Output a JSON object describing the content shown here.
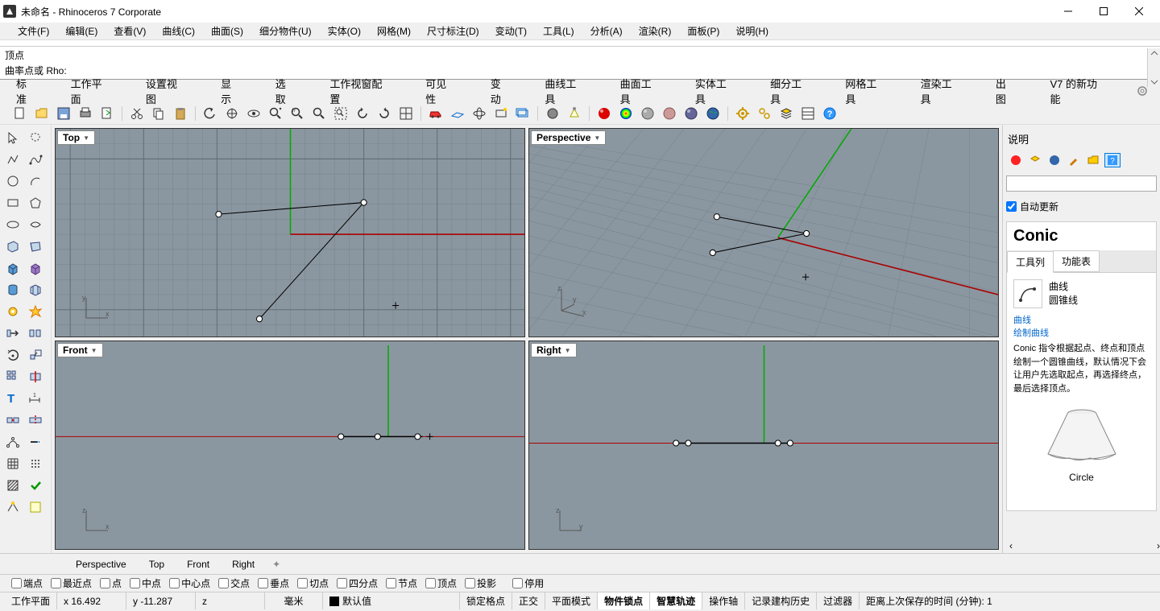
{
  "window": {
    "title": "未命名 - Rhinoceros 7 Corporate",
    "minimize": "—",
    "maximize": "☐",
    "close": "✕"
  },
  "menubar": [
    "文件(F)",
    "编辑(E)",
    "查看(V)",
    "曲线(C)",
    "曲面(S)",
    "细分物件(U)",
    "实体(O)",
    "网格(M)",
    "尺寸标注(D)",
    "变动(T)",
    "工具(L)",
    "分析(A)",
    "渲染(R)",
    "面板(P)",
    "说明(H)"
  ],
  "command": {
    "history": "顶点",
    "prompt": "曲率点或 Rho:"
  },
  "tabs": [
    "标准",
    "工作平面",
    "设置视图",
    "显示",
    "选取",
    "工作视窗配置",
    "可见性",
    "变动",
    "曲线工具",
    "曲面工具",
    "实体工具",
    "细分工具",
    "网格工具",
    "渲染工具",
    "出图",
    "V7 的新功能"
  ],
  "viewports": {
    "top": "Top",
    "perspective": "Perspective",
    "front": "Front",
    "right": "Right"
  },
  "help": {
    "title": "说明",
    "auto_update": "自动更新",
    "h1": "Conic",
    "tab1": "工具列",
    "tab2": "功能表",
    "sub1": "曲线",
    "sub2": "圆锥线",
    "link1": "曲线",
    "link2": "绘制曲线",
    "text": "Conic 指令根据起点、终点和顶点绘制一个圆锥曲线，默认情况下会让用户先选取起点，再选择终点，最后选择顶点。",
    "caption": "Circle"
  },
  "lower_tabs": [
    "Perspective",
    "Top",
    "Front",
    "Right"
  ],
  "osnap": [
    "端点",
    "最近点",
    "点",
    "中点",
    "中心点",
    "交点",
    "垂点",
    "切点",
    "四分点",
    "节点",
    "顶点",
    "投影",
    "停用"
  ],
  "status": {
    "plane": "工作平面",
    "x": "x 16.492",
    "y": "y -11.287",
    "z": "z",
    "unit": "毫米",
    "layer": "默认值",
    "items": [
      "锁定格点",
      "正交",
      "平面模式",
      "物件锁点",
      "智慧轨迹",
      "操作轴",
      "记录建构历史",
      "过滤器"
    ],
    "time": "距离上次保存的时间 (分钟): 1"
  }
}
